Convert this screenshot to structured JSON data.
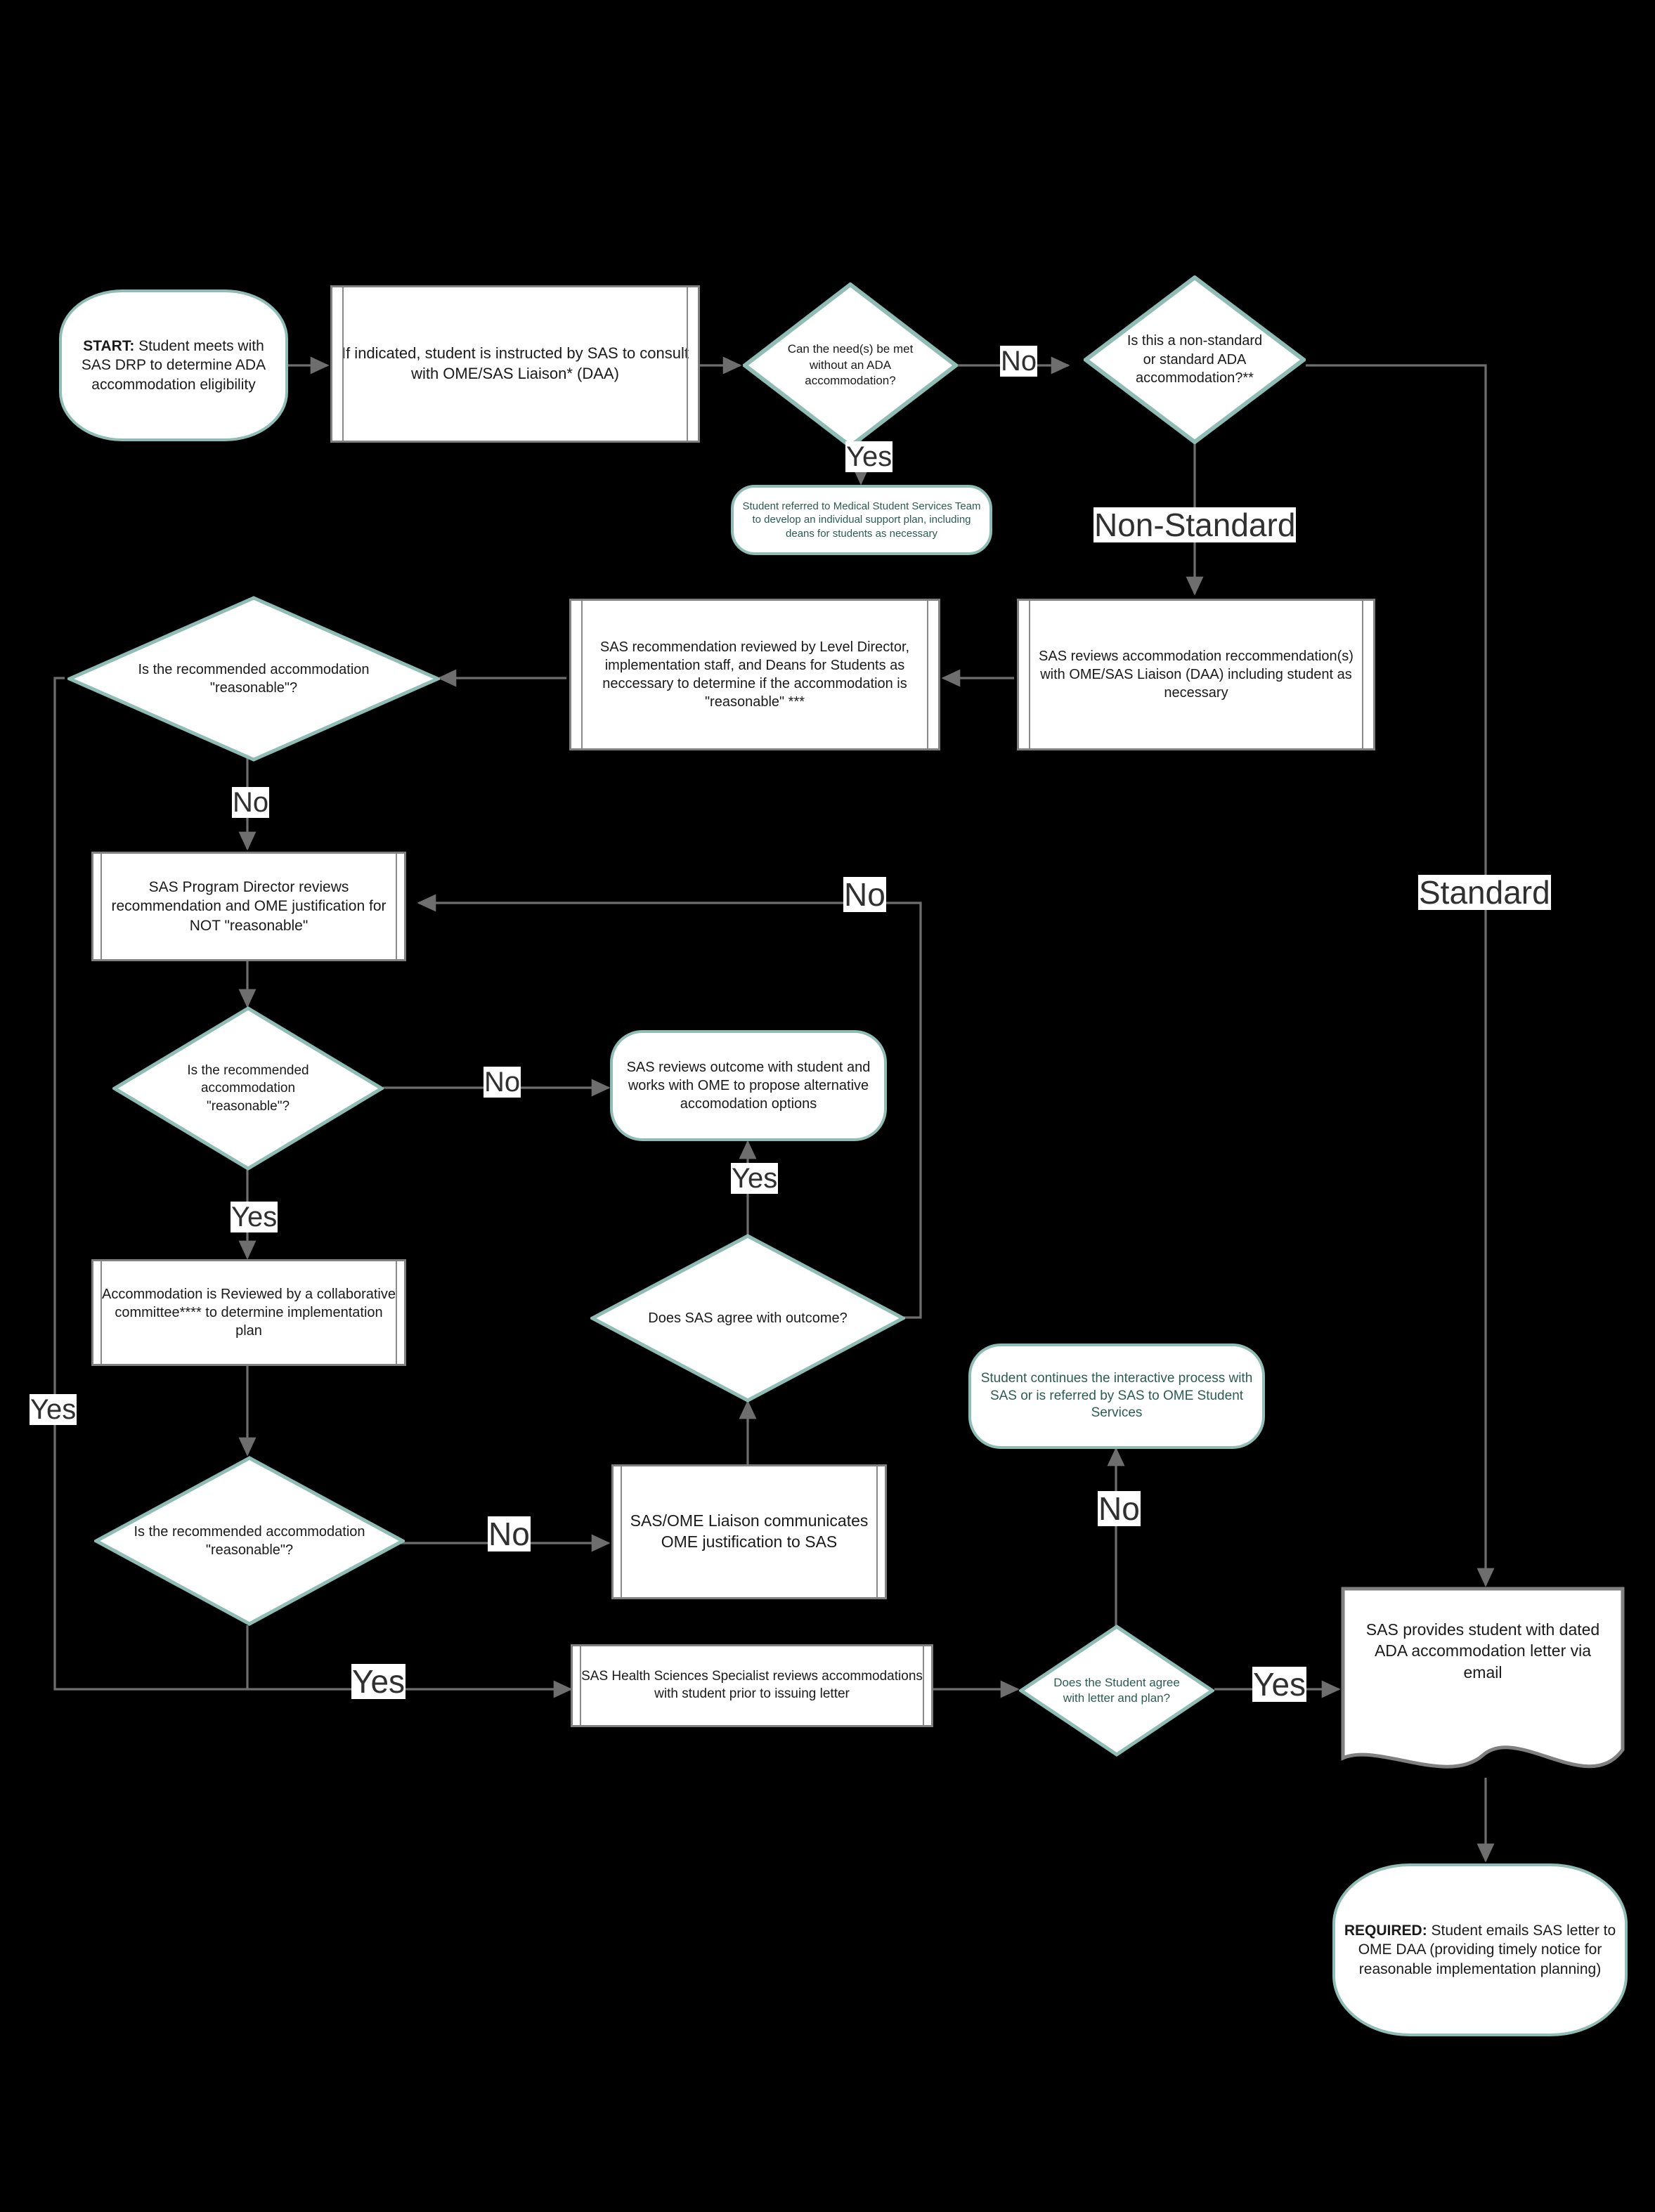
{
  "diagram": {
    "title": "ADA Accommodation Process Flowchart",
    "accent_teal": "#8FBCB4",
    "edge_gray": "#6e6e6e",
    "background": "#000000"
  },
  "nodes": {
    "start": "START: Student meets with SAS DRP to determine ADA accommodation eligibility",
    "start_bold": "START:",
    "start_rest": " Student meets with SAS DRP to determine ADA accommodation eligibility",
    "consult_liaison": "If indicated, student is instructed by SAS to consult with OME/SAS Liaison* (DAA)",
    "need_met": "Can the need(s) be met without an ADA accommodation?",
    "non_standard_q": "Is this a non-standard or standard ADA accommodation?**",
    "referred_mss": "Student referred to Medical Student Services Team to develop an individual support plan, including deans for students as necessary",
    "sas_reviews_rec": "SAS reviews accommodation reccommendation(s) with OME/SAS Liaison (DAA) including student as necessary",
    "sas_rec_reviewed": "SAS recommendation reviewed by Level Director, implementation staff, and Deans for Students as neccessary to determine if the accommodation is \"reasonable\" ***",
    "reasonable_1": "Is the recommended accommodation \"reasonable\"?",
    "sas_prog_dir": "SAS Program Director reviews recommendation and OME justification for NOT \"reasonable\"",
    "reasonable_2": "Is the recommended accommodation \"reasonable\"?",
    "sas_reviews_outcome": "SAS reviews outcome with student and works with OME to propose alternative accomodation options",
    "accom_reviewed": "Accommodation is Reviewed by a collaborative committee**** to determine implementation plan",
    "sas_agree": "Does SAS agree with outcome?",
    "student_continues": "Student continues the interactive process with SAS or is referred by SAS to OME Student Services",
    "reasonable_3": "Is the recommended accommodation \"reasonable\"?",
    "liaison_justification": "SAS/OME Liaison communicates OME justification to SAS",
    "hs_specialist": "SAS Health Sciences Specialist reviews accommodations with student prior to issuing letter",
    "student_agree_letter": "Does the Student agree with letter and plan?",
    "sas_provides_letter": "SAS provides student with dated ADA accommodation letter via email",
    "required_email": "REQUIRED: Student emails SAS letter to OME DAA (providing timely notice for reasonable implementation planning)",
    "required_bold": "REQUIRED:",
    "required_rest": " Student emails SAS letter to OME DAA (providing timely notice for reasonable implementation planning)"
  },
  "edge_labels": {
    "no_need_met": "No",
    "yes_need_met": "Yes",
    "non_standard": "Non-Standard",
    "standard": "Standard",
    "no_reasonable_1": "No",
    "yes_reasonable_1": "Yes",
    "no_reasonable_2": "No",
    "yes_reasonable_2": "Yes",
    "yes_sas_agree": "Yes",
    "no_sas_agree": "No",
    "no_reasonable_3": "No",
    "yes_reasonable_3": "Yes",
    "no_student_agree": "No",
    "yes_student_agree": "Yes"
  }
}
